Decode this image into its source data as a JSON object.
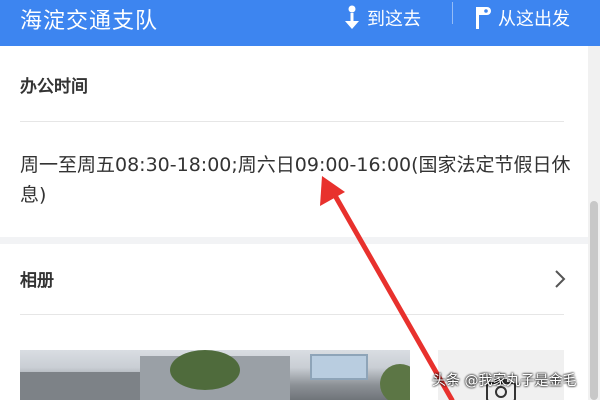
{
  "header": {
    "title": "海淀交通支队",
    "goto_label": "到这去",
    "from_label": "从这出发",
    "background": "#3d85f0"
  },
  "office_hours": {
    "title": "办公时间",
    "text": "周一至周五08:30-18:00;周六日09:00-16:00(国家法定节假日休息)"
  },
  "album": {
    "title": "相册",
    "chevron_icon": "chevron-right-icon",
    "camera_icon": "camera-icon"
  },
  "watermark": "头条 @我家丸子是金毛",
  "annotation": {
    "arrow_color": "#e8312d"
  }
}
